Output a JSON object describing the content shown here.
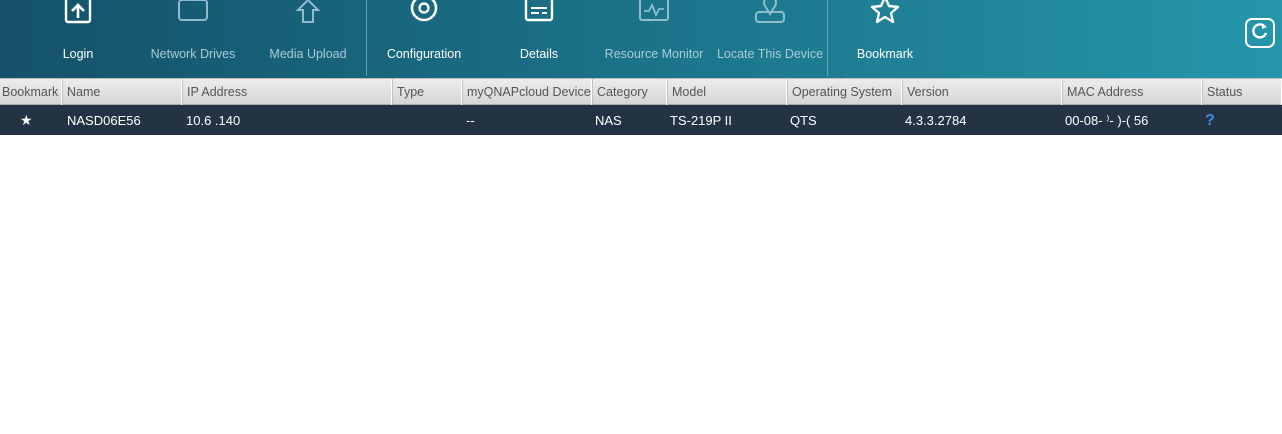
{
  "toolbar": {
    "buttons": [
      {
        "label": "Login",
        "icon": "login-icon",
        "enabled": true
      },
      {
        "label": "Network Drives",
        "icon": "network-drives-icon",
        "enabled": false
      },
      {
        "label": "Media Upload",
        "icon": "media-upload-icon",
        "enabled": false
      },
      {
        "label": "Configuration",
        "icon": "gear-icon",
        "enabled": true
      },
      {
        "label": "Details",
        "icon": "details-icon",
        "enabled": true
      },
      {
        "label": "Resource Monitor",
        "icon": "resource-monitor-icon",
        "enabled": false
      },
      {
        "label": "Locate This Device",
        "icon": "locate-device-icon",
        "enabled": false
      },
      {
        "label": "Bookmark",
        "icon": "star-icon",
        "enabled": true
      }
    ],
    "refresh_icon": "refresh-icon"
  },
  "table": {
    "sorted_column": "Operating System",
    "columns": [
      "Bookmark",
      "Name",
      "IP Address",
      "Type",
      "myQNAPcloud Device",
      "Category",
      "Model",
      "Operating System",
      "Version",
      "MAC Address",
      "Status"
    ],
    "rows": [
      {
        "bookmark": "★",
        "name": "NASD06E56",
        "ip": "10.6      .140",
        "type": "",
        "myqnapcloud": "--",
        "category": "NAS",
        "model": "TS-219P II",
        "os": "QTS",
        "version": "4.3.3.2784",
        "mac": "00-08-  ⁾-  )-(   56",
        "status": "?"
      }
    ]
  },
  "colors": {
    "toolbar_start": "#14526a",
    "toolbar_end": "#2596aa",
    "selected_row": "#233343",
    "status_unknown": "#3b8be6"
  }
}
